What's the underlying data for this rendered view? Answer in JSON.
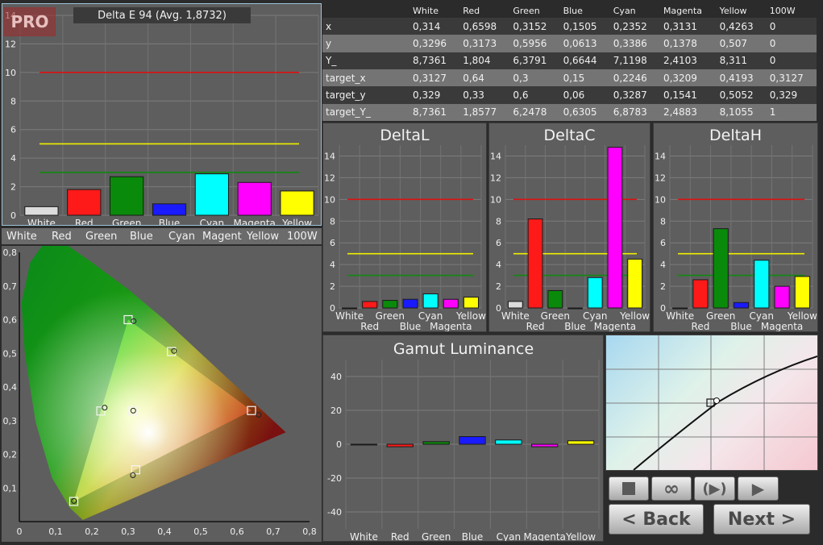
{
  "app_badge": "PRO",
  "table": {
    "headers": [
      "",
      "White",
      "Red",
      "Green",
      "Blue",
      "Cyan",
      "Magenta",
      "Yellow",
      "100W"
    ],
    "rows": [
      [
        "x",
        "0,314",
        "0,6598",
        "0,3152",
        "0,1505",
        "0,2352",
        "0,3131",
        "0,4263",
        "0"
      ],
      [
        "y",
        "0,3296",
        "0,3173",
        "0,5956",
        "0,0613",
        "0,3386",
        "0,1378",
        "0,507",
        "0"
      ],
      [
        "Y_",
        "8,7361",
        "1,804",
        "6,3791",
        "0,6644",
        "7,1198",
        "2,4103",
        "8,311",
        "0"
      ],
      [
        "target_x",
        "0,3127",
        "0,64",
        "0,3",
        "0,15",
        "0,2246",
        "0,3209",
        "0,4193",
        "0,3127"
      ],
      [
        "target_y",
        "0,329",
        "0,33",
        "0,6",
        "0,06",
        "0,3287",
        "0,1541",
        "0,5052",
        "0,329"
      ],
      [
        "target_Y_",
        "8,7361",
        "1,8577",
        "6,2478",
        "0,6305",
        "6,8783",
        "2,4883",
        "8,1055",
        "1"
      ]
    ]
  },
  "colors": {
    "White": "#dcdcdc",
    "Red": "#ff1a1a",
    "Green": "#0a8a0a",
    "Blue": "#1a1aff",
    "Cyan": "#00ffff",
    "Magenta": "#ff00ff",
    "Yellow": "#ffff00",
    "ref_red": "#dd1111",
    "ref_yellow": "#eeee00",
    "ref_green": "#118811"
  },
  "swatch_strip": [
    "White",
    "Red",
    "Green",
    "Blue",
    "Cyan",
    "Magent",
    "Yellow",
    "100W"
  ],
  "chart_data": [
    {
      "id": "delta-e",
      "type": "bar",
      "title": "Delta E 94 (Avg. 1,8732)",
      "categories": [
        "White",
        "Red",
        "Green",
        "Blue",
        "Cyan",
        "Magenta",
        "Yellow"
      ],
      "values": [
        0.6,
        1.8,
        2.7,
        0.8,
        2.9,
        2.3,
        1.7
      ],
      "ylim": [
        0,
        14
      ],
      "yticks": [
        0,
        2,
        4,
        6,
        8,
        10,
        12,
        14
      ],
      "ref_lines": [
        10,
        5,
        3
      ]
    },
    {
      "id": "delta-l",
      "type": "bar",
      "title": "DeltaL",
      "categories": [
        "White",
        "Red",
        "Green",
        "Blue",
        "Cyan",
        "Magenta",
        "Yellow"
      ],
      "values": [
        0,
        0.6,
        0.7,
        0.8,
        1.3,
        0.8,
        1.0
      ],
      "ylim": [
        0,
        15
      ],
      "yticks": [
        0,
        2,
        4,
        6,
        8,
        10,
        12,
        14
      ],
      "ref_lines": [
        10,
        5,
        3
      ]
    },
    {
      "id": "delta-c",
      "type": "bar",
      "title": "DeltaC",
      "categories": [
        "White",
        "Red",
        "Green",
        "Blue",
        "Cyan",
        "Magenta",
        "Yellow"
      ],
      "values": [
        0.6,
        8.2,
        1.6,
        0,
        2.8,
        14.8,
        4.5
      ],
      "ylim": [
        0,
        15
      ],
      "yticks": [
        0,
        2,
        4,
        6,
        8,
        10,
        12,
        14
      ],
      "ref_lines": [
        10,
        5,
        3
      ]
    },
    {
      "id": "delta-h",
      "type": "bar",
      "title": "DeltaH",
      "categories": [
        "White",
        "Red",
        "Green",
        "Blue",
        "Cyan",
        "Magenta",
        "Yellow"
      ],
      "values": [
        0,
        2.6,
        7.3,
        0.5,
        4.4,
        2.0,
        2.9
      ],
      "ylim": [
        0,
        15
      ],
      "yticks": [
        0,
        2,
        4,
        6,
        8,
        10,
        12,
        14
      ],
      "ref_lines": [
        10,
        5,
        3
      ]
    },
    {
      "id": "gamut-luminance",
      "type": "bar",
      "title": "Gamut Luminance",
      "categories": [
        "White",
        "Red",
        "Green",
        "Blue",
        "Cyan",
        "Magenta",
        "Yellow"
      ],
      "values": [
        0,
        -1.5,
        1.5,
        4.5,
        2.5,
        -1.5,
        2
      ],
      "ylim": [
        -50,
        50
      ],
      "yticks": [
        -40,
        -20,
        0,
        20,
        40
      ]
    },
    {
      "id": "cie",
      "type": "scatter",
      "x_ticks": [
        "0",
        "0,1",
        "0,2",
        "0,3",
        "0,4",
        "0,5",
        "0,6",
        "0,7",
        "0,8"
      ],
      "y_ticks": [
        "0,1",
        "0,2",
        "0,3",
        "0,4",
        "0,5",
        "0,6",
        "0,7",
        "0,8"
      ],
      "xlim": [
        0,
        0.8
      ],
      "ylim": [
        0,
        0.8
      ],
      "targets": [
        [
          0.64,
          0.33
        ],
        [
          0.3,
          0.6
        ],
        [
          0.15,
          0.06
        ],
        [
          0.2246,
          0.3287
        ],
        [
          0.3209,
          0.1541
        ],
        [
          0.4193,
          0.5052
        ],
        [
          0.3127,
          0.329
        ]
      ],
      "measured": [
        [
          0.6598,
          0.3173
        ],
        [
          0.3152,
          0.5956
        ],
        [
          0.1505,
          0.0613
        ],
        [
          0.2352,
          0.3386
        ],
        [
          0.3131,
          0.1378
        ],
        [
          0.4263,
          0.507
        ],
        [
          0.314,
          0.3296
        ]
      ]
    }
  ],
  "buttons": {
    "back": "< Back",
    "next": "Next >"
  }
}
